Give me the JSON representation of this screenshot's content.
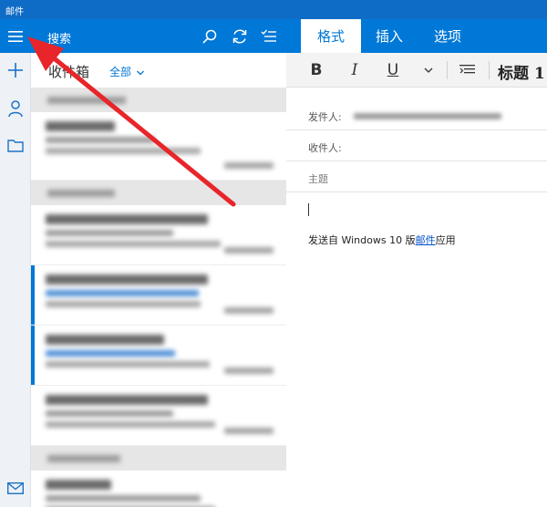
{
  "window": {
    "title": "邮件"
  },
  "rail": {
    "menu_icon": "hamburger-icon",
    "new_mail_icon": "plus-icon",
    "accounts_icon": "person-icon",
    "folders_icon": "folder-icon",
    "mail_icon": "envelope-icon"
  },
  "list_header": {
    "search_label": "搜索",
    "search_icon": "search-icon",
    "sync_icon": "sync-icon",
    "select_icon": "select-mode-icon"
  },
  "list": {
    "folder_name": "收件箱",
    "filter_label": "全部",
    "filter_icon": "chevron-down-icon"
  },
  "compose": {
    "tabs": [
      {
        "label": "格式",
        "active": true
      },
      {
        "label": "插入",
        "active": false
      },
      {
        "label": "选项",
        "active": false
      }
    ],
    "toolbar": {
      "bold": "B",
      "italic": "I",
      "underline": "U",
      "style_label": "标题 1"
    },
    "from_label": "发件人:",
    "to_label": "收件人:",
    "subject_placeholder": "主题",
    "signature": {
      "prefix": "发送自  Windows 10  版",
      "link": "邮件",
      "suffix": "应用"
    }
  },
  "colors": {
    "accent": "#0078d7",
    "titlebar": "#0f6cc6",
    "annotation_arrow": "#e8252a"
  }
}
